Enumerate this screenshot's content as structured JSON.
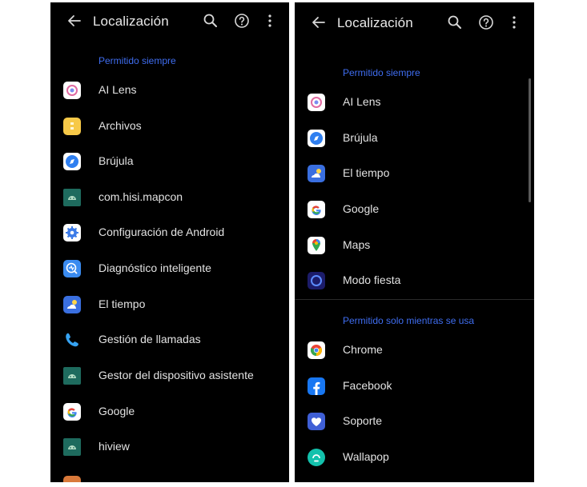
{
  "left_screen": {
    "title": "Localización",
    "section_label": "Permitido siempre",
    "apps": [
      {
        "label": "AI Lens",
        "icon": "ai-lens-icon"
      },
      {
        "label": "Archivos",
        "icon": "files-icon"
      },
      {
        "label": "Brújula",
        "icon": "compass-icon"
      },
      {
        "label": "com.hisi.mapcon",
        "icon": "android-icon"
      },
      {
        "label": "Configuración de Android",
        "icon": "gear-icon"
      },
      {
        "label": "Diagnóstico inteligente",
        "icon": "diagnostics-icon"
      },
      {
        "label": "El tiempo",
        "icon": "weather-icon"
      },
      {
        "label": "Gestión de llamadas",
        "icon": "phone-icon"
      },
      {
        "label": "Gestor del dispositivo asistente",
        "icon": "android-icon"
      },
      {
        "label": "Google",
        "icon": "google-icon"
      },
      {
        "label": "hiview",
        "icon": "android-icon"
      }
    ]
  },
  "right_screen": {
    "title": "Localización",
    "section_always": "Permitido siempre",
    "apps_always": [
      {
        "label": "AI Lens",
        "icon": "ai-lens-icon"
      },
      {
        "label": "Brújula",
        "icon": "compass-icon"
      },
      {
        "label": "El tiempo",
        "icon": "weather-icon"
      },
      {
        "label": "Google",
        "icon": "google-icon"
      },
      {
        "label": "Maps",
        "icon": "maps-icon"
      },
      {
        "label": "Modo fiesta",
        "icon": "party-mode-icon"
      }
    ],
    "section_while_using": "Permitido solo mientras se usa",
    "apps_while_using": [
      {
        "label": "Chrome",
        "icon": "chrome-icon"
      },
      {
        "label": "Facebook",
        "icon": "facebook-icon"
      },
      {
        "label": "Soporte",
        "icon": "support-icon"
      },
      {
        "label": "Wallapop",
        "icon": "wallapop-icon"
      }
    ]
  },
  "colors": {
    "background": "#000000",
    "accent": "#3f6df0",
    "text": "#e2e2e2"
  }
}
